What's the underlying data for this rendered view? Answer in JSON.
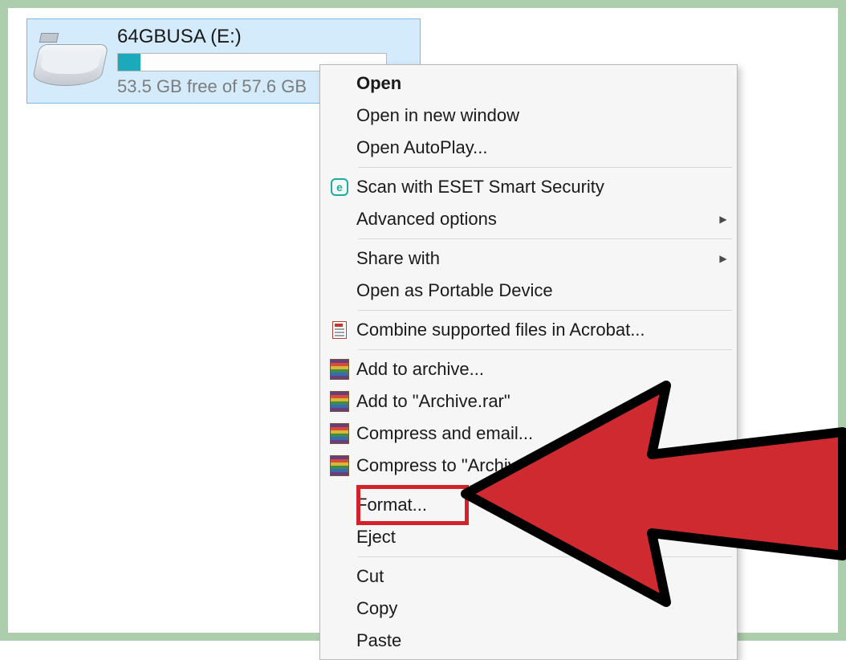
{
  "drive": {
    "label": "64GBUSA (E:)",
    "free_text": "53.5 GB free of 57.6 GB"
  },
  "menu": {
    "open": "Open",
    "open_new_window": "Open in new window",
    "open_autoplay": "Open AutoPlay...",
    "scan_eset": "Scan with ESET Smart Security",
    "advanced_options": "Advanced options",
    "share_with": "Share with",
    "open_portable": "Open as Portable Device",
    "combine_acrobat": "Combine supported files in Acrobat...",
    "add_archive": "Add to archive...",
    "add_archive_rar": "Add to \"Archive.rar\"",
    "compress_email": "Compress and email...",
    "compress_to": "Compress to \"Archive.rar\" and email",
    "format": "Format...",
    "eject": "Eject",
    "cut": "Cut",
    "copy": "Copy",
    "paste": "Paste"
  },
  "highlight_target": "format"
}
